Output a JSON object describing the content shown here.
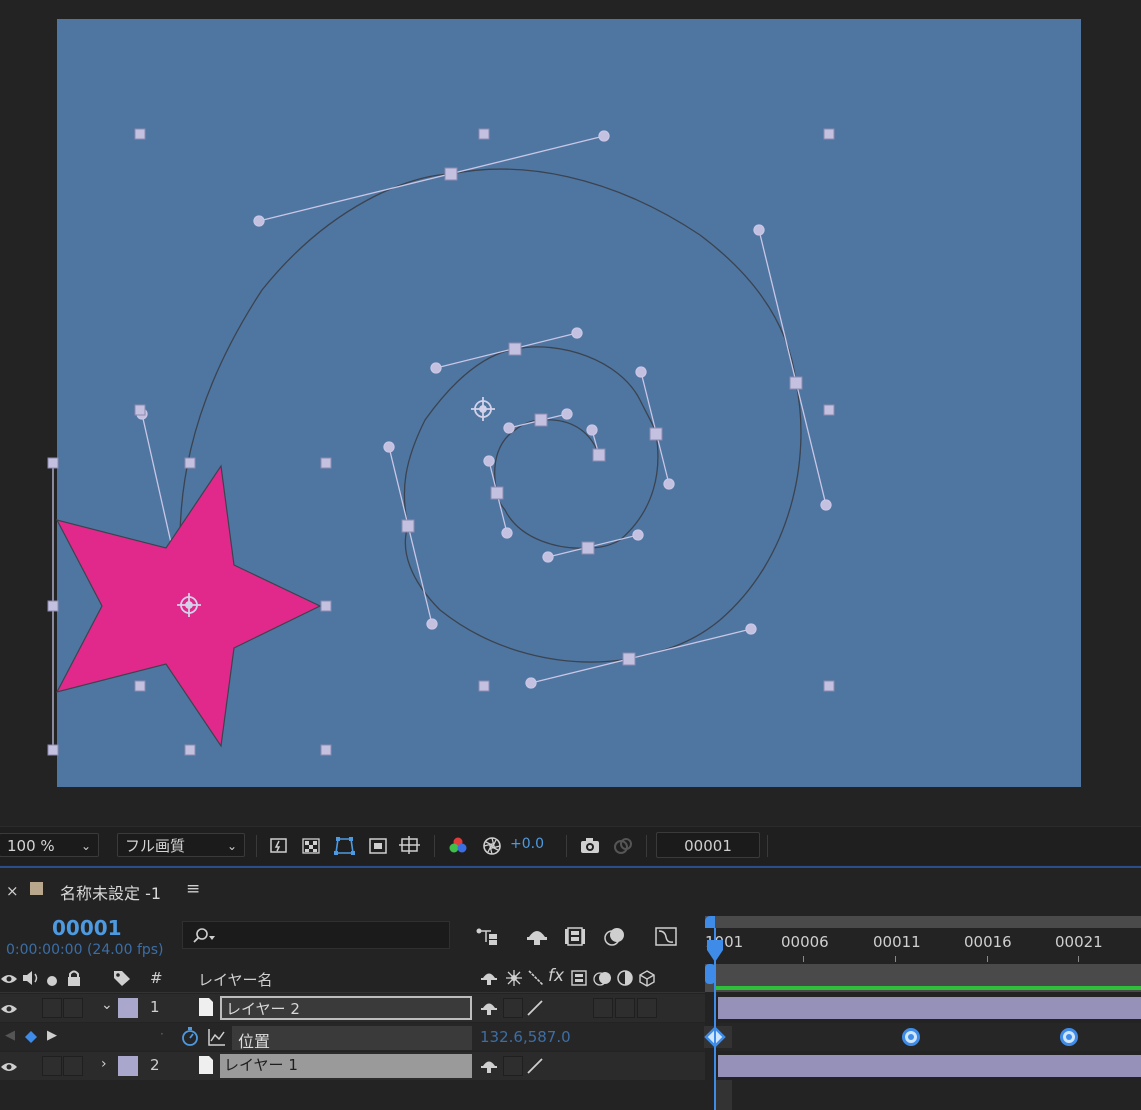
{
  "viewer": {
    "zoom": "100 %",
    "quality": "フル画質",
    "exposure": "+0.0",
    "current_frame_field": "00001",
    "comp_bg_color": "#4f76a0",
    "star_color": "#e0298a",
    "path_color": "#b6b3d4"
  },
  "timeline": {
    "comp_name": "名称未設定 -1",
    "current_frame": "00001",
    "timecode": "0:00:00:00 (24.00 fps)",
    "columns": {
      "number": "#",
      "layer_name": "レイヤー名"
    },
    "ruler_ticks": [
      "1001",
      "00006",
      "00011",
      "00016",
      "00021"
    ],
    "layers": [
      {
        "index": "1",
        "name": "レイヤー 2",
        "label_color": "#aaa7cc",
        "expanded": true,
        "selected": true
      },
      {
        "index": "2",
        "name": "レイヤー 1",
        "label_color": "#aaa7cc",
        "expanded": false,
        "selected": false
      }
    ],
    "property": {
      "name": "位置",
      "value": "132.6,587.0"
    },
    "colors": {
      "accent": "#4e9ae0",
      "layer_bar": "#9591b8",
      "work_area_green": "#2fbf3a"
    }
  }
}
